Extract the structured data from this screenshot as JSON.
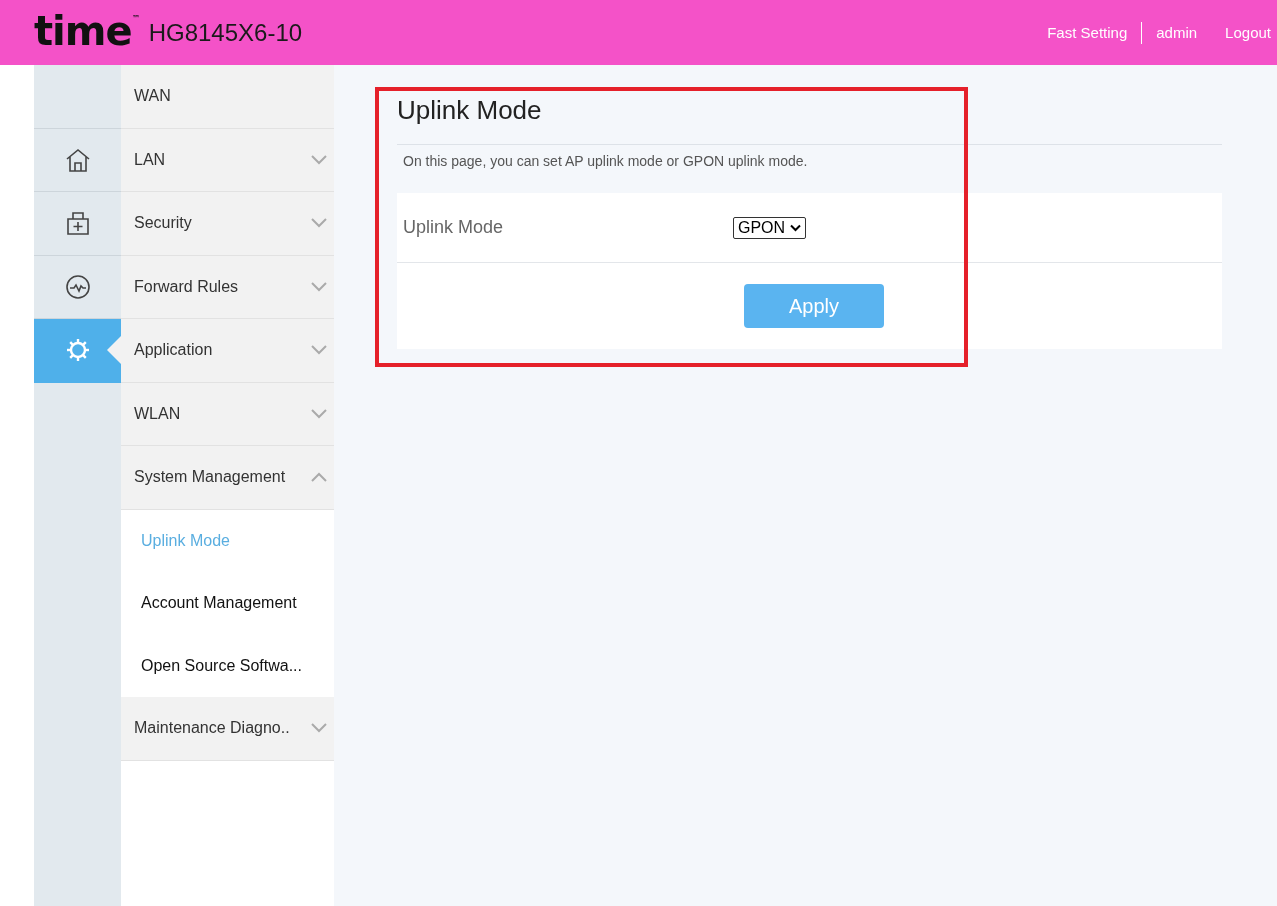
{
  "header": {
    "brand": "time",
    "trademark": "™",
    "model": "HG8145X6-10",
    "links": [
      "Fast Setting",
      "admin",
      "Logout"
    ]
  },
  "rail": [
    {
      "kind": "home",
      "selected": false
    },
    {
      "kind": "toolbox",
      "selected": false
    },
    {
      "kind": "monitor",
      "selected": false
    },
    {
      "kind": "gear",
      "selected": true
    }
  ],
  "menu": [
    {
      "label": "WAN",
      "kind": "leaf"
    },
    {
      "label": "LAN",
      "kind": "group",
      "expanded": false
    },
    {
      "label": "Security",
      "kind": "group",
      "expanded": false
    },
    {
      "label": "Forward Rules",
      "kind": "group",
      "expanded": false
    },
    {
      "label": "Application",
      "kind": "group",
      "expanded": false
    },
    {
      "label": "WLAN",
      "kind": "group",
      "expanded": false
    },
    {
      "label": "System Management",
      "kind": "group",
      "expanded": true,
      "children": [
        {
          "label": "Uplink Mode",
          "selected": true
        },
        {
          "label": "Account Management",
          "selected": false
        },
        {
          "label": "Open Source Softwa...",
          "selected": false
        }
      ]
    },
    {
      "label": "Maintenance Diagno..",
      "kind": "group",
      "expanded": false
    }
  ],
  "page": {
    "title": "Uplink Mode",
    "description": "On this page, you can set AP uplink mode or GPON uplink mode.",
    "field_label": "Uplink Mode",
    "select_value": "GPON",
    "apply": "Apply",
    "highlighted": true
  }
}
